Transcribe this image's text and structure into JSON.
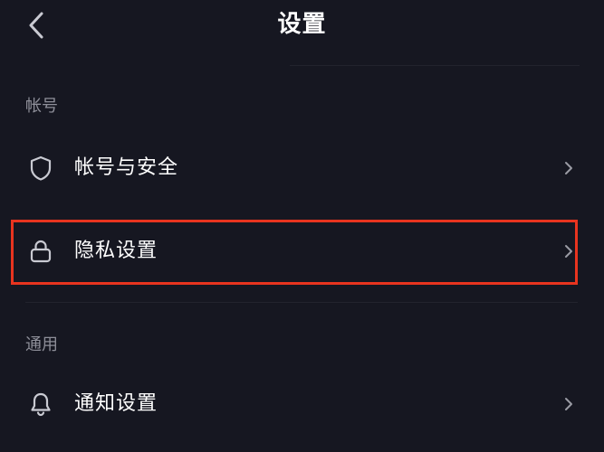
{
  "header": {
    "title": "设置",
    "back_icon": "chevron-left-icon"
  },
  "sections": [
    {
      "label": "帐号",
      "items": [
        {
          "label": "帐号与安全",
          "icon": "shield-icon"
        },
        {
          "label": "隐私设置",
          "icon": "lock-icon",
          "highlighted": true
        }
      ]
    },
    {
      "label": "通用",
      "items": [
        {
          "label": "通知设置",
          "icon": "bell-icon"
        }
      ]
    }
  ],
  "colors": {
    "background": "#161721",
    "text": "#ffffff",
    "section_label": "#8e8f99",
    "icon": "#c9cad2",
    "highlight_border": "#e8341f"
  }
}
